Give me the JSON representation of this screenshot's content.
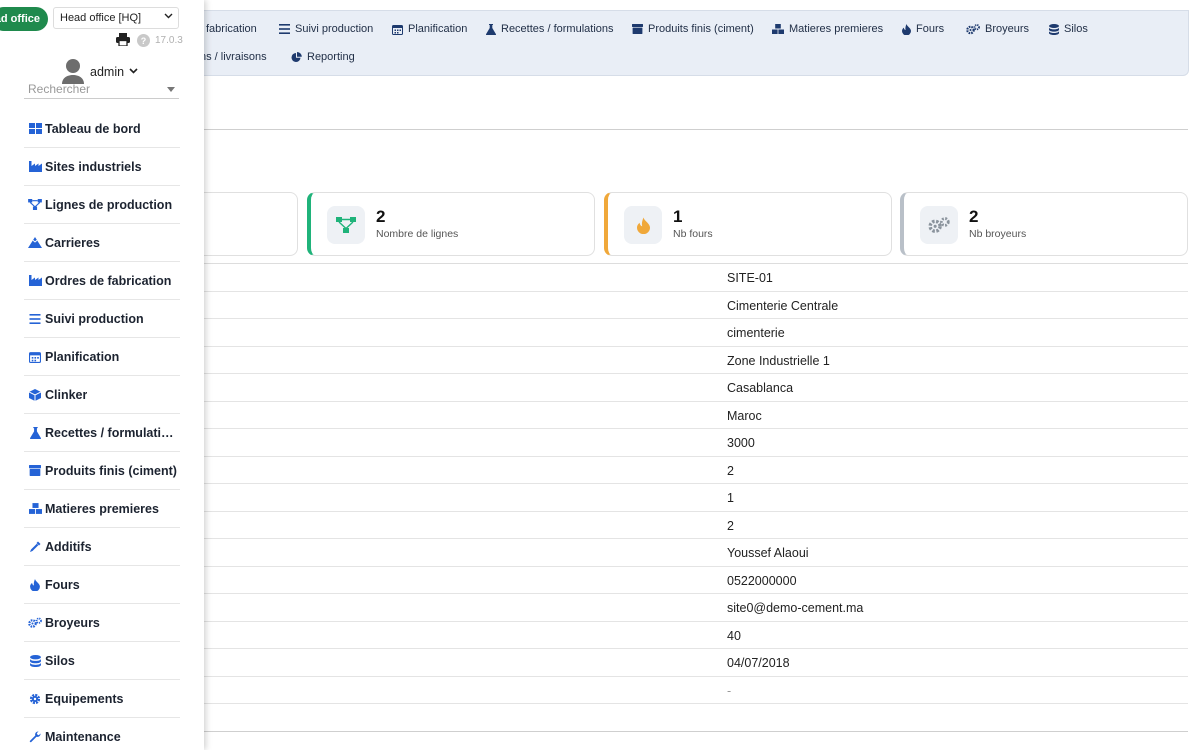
{
  "company": {
    "badge": "Head office",
    "select_value": "Head office [HQ]"
  },
  "header": {
    "version": "17.0.3",
    "user": "admin"
  },
  "search": {
    "placeholder": "Rechercher"
  },
  "sidebar": {
    "items": [
      {
        "label": "Tableau de bord",
        "icon": "dashboard-icon"
      },
      {
        "label": "Sites industriels",
        "icon": "factory-icon"
      },
      {
        "label": "Lignes de production",
        "icon": "network-icon"
      },
      {
        "label": "Carrieres",
        "icon": "mountain-icon"
      },
      {
        "label": "Ordres de fabrication",
        "icon": "factory-icon"
      },
      {
        "label": "Suivi production",
        "icon": "list-icon"
      },
      {
        "label": "Planification",
        "icon": "calendar-icon"
      },
      {
        "label": "Clinker",
        "icon": "cube-icon"
      },
      {
        "label": "Recettes / formulatio…",
        "icon": "flask-icon"
      },
      {
        "label": "Produits finis (ciment)",
        "icon": "box-icon"
      },
      {
        "label": "Matieres premieres",
        "icon": "boxes-icon"
      },
      {
        "label": "Additifs",
        "icon": "eyedropper-icon"
      },
      {
        "label": "Fours",
        "icon": "flame-icon"
      },
      {
        "label": "Broyeurs",
        "icon": "gears-icon"
      },
      {
        "label": "Silos",
        "icon": "database-icon"
      },
      {
        "label": "Equipements",
        "icon": "gear-icon"
      },
      {
        "label": "Maintenance",
        "icon": "wrench-icon"
      }
    ]
  },
  "topmenu": {
    "row1": [
      {
        "label": "fabrication",
        "icon": "factory-icon"
      },
      {
        "label": "Suivi production",
        "icon": "list-icon"
      },
      {
        "label": "Planification",
        "icon": "calendar-icon"
      },
      {
        "label": "Recettes / formulations",
        "icon": "flask-icon"
      },
      {
        "label": "Produits finis (ciment)",
        "icon": "box-icon"
      },
      {
        "label": "Matieres premieres",
        "icon": "boxes-icon"
      },
      {
        "label": "Fours",
        "icon": "flame-icon"
      },
      {
        "label": "Broyeurs",
        "icon": "gears-icon"
      },
      {
        "label": "Silos",
        "icon": "database-icon"
      }
    ],
    "row2": [
      {
        "label": "ns / livraisons",
        "icon": ""
      },
      {
        "label": "Reporting",
        "icon": "pie-chart-icon"
      }
    ]
  },
  "stats": [
    {
      "value": "2",
      "label": "Nombre de lignes",
      "icon": "network-icon",
      "color": "#1fb37a"
    },
    {
      "value": "1",
      "label": "Nb fours",
      "icon": "flame-icon",
      "color": "#f0a83a"
    },
    {
      "value": "2",
      "label": "Nb broyeurs",
      "icon": "gears-icon",
      "color": "#b9c0c8"
    }
  ],
  "details": [
    "SITE-01",
    "Cimenterie Centrale",
    "cimenterie",
    "Zone Industrielle 1",
    "Casablanca",
    "Maroc",
    "3000",
    "2",
    "1",
    "2",
    "Youssef Alaoui",
    "0522000000",
    "site0@demo-cement.ma",
    "40",
    "04/07/2018",
    "-"
  ],
  "colors": {
    "accent": "#2563d6",
    "company_badge": "#1f8a4d",
    "topmenu_bg": "#e9eef6"
  }
}
